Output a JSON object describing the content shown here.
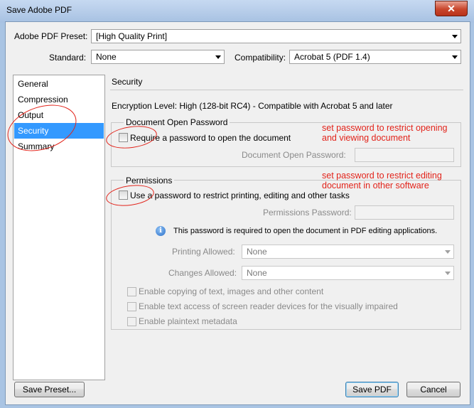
{
  "window": {
    "title": "Save Adobe PDF",
    "close_glyph": "✕"
  },
  "preset": {
    "label": "Adobe PDF Preset:",
    "value": "[High Quality Print]"
  },
  "standard": {
    "label": "Standard:",
    "value": "None"
  },
  "compatibility": {
    "label": "Compatibility:",
    "value": "Acrobat 5 (PDF 1.4)"
  },
  "sidebar": {
    "items": [
      {
        "label": "General"
      },
      {
        "label": "Compression"
      },
      {
        "label": "Output"
      },
      {
        "label": "Security"
      },
      {
        "label": "Summary"
      }
    ],
    "selected_index": 3
  },
  "section": {
    "title": "Security",
    "encryption": "Encryption Level: High (128-bit RC4) - Compatible with Acrobat 5 and later"
  },
  "open_password": {
    "group_title": "Document Open Password",
    "checkbox_label": "Require a password to open the document",
    "field_label": "Document Open Password:",
    "checked": false
  },
  "permissions": {
    "group_title": "Permissions",
    "checkbox_label": "Use a password to restrict printing, editing and other tasks",
    "field_label": "Permissions Password:",
    "info": "This password is required to open the document in PDF editing applications.",
    "printing_label": "Printing Allowed:",
    "printing_value": "None",
    "changes_label": "Changes Allowed:",
    "changes_value": "None",
    "options": [
      {
        "label": "Enable copying of text, images and other content"
      },
      {
        "label": "Enable text access of screen reader devices for the visually impaired"
      },
      {
        "label": "Enable plaintext metadata"
      }
    ]
  },
  "annotations": {
    "note1_line1": "set password to restrict opening",
    "note1_line2": "and viewing document",
    "note2_line1": "set password to restrict editing",
    "note2_line2": "document in other software",
    "color": "#e2231a"
  },
  "buttons": {
    "save_preset": "Save Preset...",
    "save_pdf": "Save PDF",
    "cancel": "Cancel"
  },
  "icons": {
    "info": "info-icon",
    "close": "close-icon",
    "dropdown": "chevron-down-icon"
  }
}
